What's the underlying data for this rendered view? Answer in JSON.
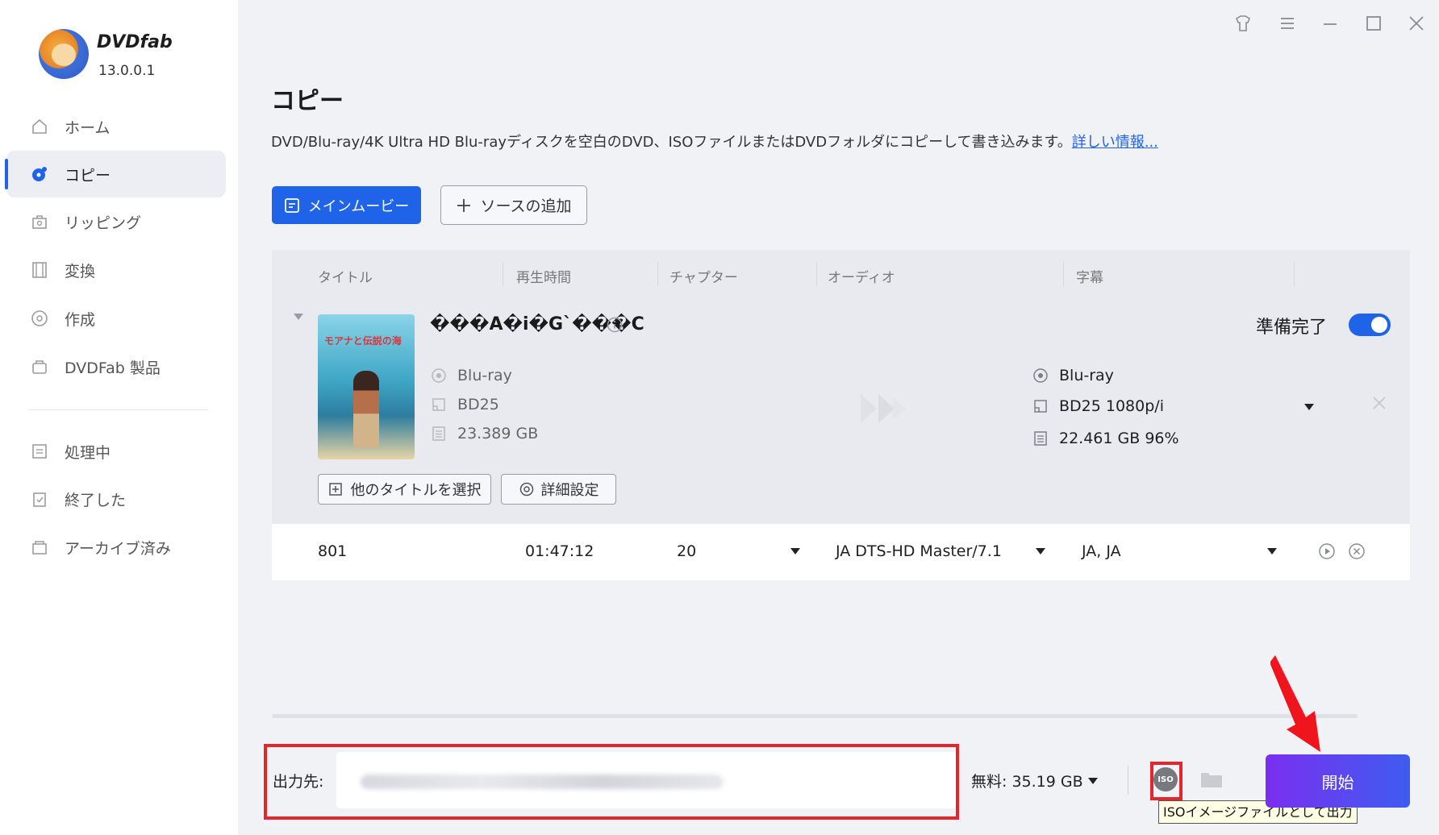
{
  "app": {
    "brand": "DVDfab",
    "version": "13.0.0.1"
  },
  "nav": {
    "items": [
      {
        "label": "ホーム",
        "icon": "home-icon"
      },
      {
        "label": "コピー",
        "icon": "copy-disc-icon"
      },
      {
        "label": "リッピング",
        "icon": "ripping-icon"
      },
      {
        "label": "変換",
        "icon": "film-icon"
      },
      {
        "label": "作成",
        "icon": "create-disc-icon"
      },
      {
        "label": "DVDFab 製品",
        "icon": "products-icon"
      },
      {
        "label": "処理中",
        "icon": "processing-icon"
      },
      {
        "label": "終了した",
        "icon": "finished-icon"
      },
      {
        "label": "アーカイブ済み",
        "icon": "archive-icon"
      }
    ],
    "active": "コピー"
  },
  "page": {
    "title": "コピー",
    "description": "DVD/Blu-ray/4K Ultra HD Blu-rayディスクを空白のDVD、ISOファイルまたはDVDフォルダにコピーして書き込みます。",
    "more_link": "詳しい情報..."
  },
  "toolbar": {
    "main_movie": "メインムービー",
    "add_source": "ソースの追加"
  },
  "columns": [
    "タイトル",
    "再生時間",
    "チャプター",
    "オーディオ",
    "字幕"
  ],
  "movie": {
    "title": "���A�i�G`���C",
    "poster_text": "モアナと伝説の海",
    "source": {
      "disc_type": "Blu-ray",
      "format": "BD25",
      "size": "23.389 GB"
    },
    "output": {
      "disc_type": "Blu-ray",
      "format": "BD25 1080p/i",
      "size": "22.461 GB 96%"
    },
    "ready_label": "準備完了",
    "ready": true,
    "select_other": "他のタイトルを選択",
    "advanced": "詳細設定"
  },
  "track_row": {
    "title": "801",
    "duration": "01:47:12",
    "chapters": "20",
    "audio": "JA  DTS-HD Master/7.1",
    "subtitles": "JA, JA"
  },
  "bottom": {
    "output_label": "出力先:",
    "free_space": "無料: 35.19 GB",
    "iso_icon_text": "ISO",
    "iso_tooltip": "ISOイメージファイルとして出力",
    "start": "開始"
  },
  "colors": {
    "accent": "#1f63e8",
    "highlight": "#e5242b",
    "start_gradient": [
      "#7a2ff0",
      "#3e5cf0"
    ]
  }
}
